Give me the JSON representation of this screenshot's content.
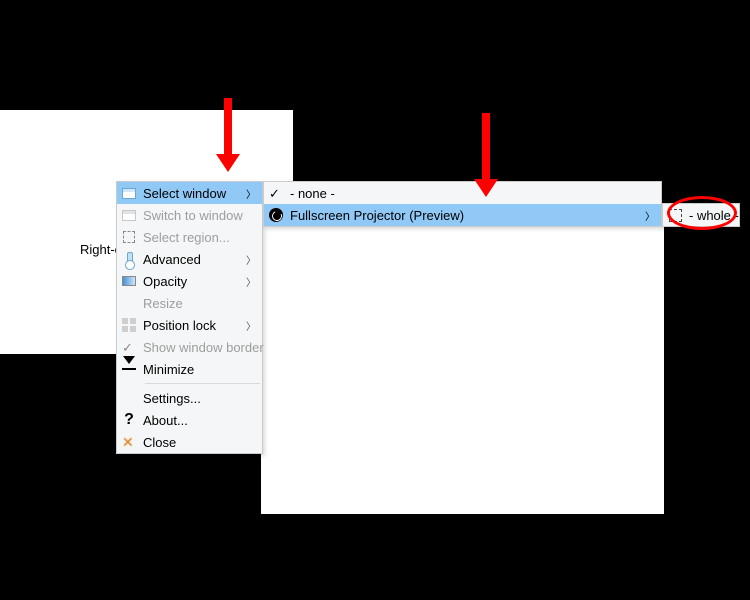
{
  "partial_text": "Right-c",
  "menu1": {
    "items": [
      {
        "label": "Select window",
        "enabled": true,
        "hasSub": true,
        "selected": true,
        "icon": "window-icon"
      },
      {
        "label": "Switch to window",
        "enabled": false,
        "hasSub": false,
        "selected": false,
        "icon": "window-icon-dim"
      },
      {
        "label": "Select region...",
        "enabled": false,
        "hasSub": false,
        "selected": false,
        "icon": "region-icon"
      },
      {
        "label": "Advanced",
        "enabled": true,
        "hasSub": true,
        "selected": false,
        "icon": "thermometer-icon"
      },
      {
        "label": "Opacity",
        "enabled": true,
        "hasSub": true,
        "selected": false,
        "icon": "opacity-icon"
      },
      {
        "label": "Resize",
        "enabled": false,
        "hasSub": false,
        "selected": false,
        "icon": ""
      },
      {
        "label": "Position lock",
        "enabled": true,
        "hasSub": true,
        "selected": false,
        "icon": "grid-icon"
      },
      {
        "label": "Show window border",
        "enabled": false,
        "hasSub": false,
        "selected": false,
        "icon": "check-icon"
      },
      {
        "label": "Minimize",
        "enabled": true,
        "hasSub": false,
        "selected": false,
        "icon": "minimize-icon"
      }
    ],
    "footer": [
      {
        "label": "Settings...",
        "icon": ""
      },
      {
        "label": "About...",
        "icon": "question-icon"
      },
      {
        "label": "Close",
        "icon": "close-icon"
      }
    ]
  },
  "menu2": {
    "items": [
      {
        "label": "- none -",
        "selected": false,
        "hasSub": false,
        "icon": "check-dark-icon"
      },
      {
        "label": "Fullscreen Projector (Preview)",
        "selected": true,
        "hasSub": true,
        "icon": "obs-icon"
      }
    ]
  },
  "menu3": {
    "items": [
      {
        "label": "- whole -",
        "selected": false,
        "icon": "dashed-square-icon"
      }
    ]
  }
}
